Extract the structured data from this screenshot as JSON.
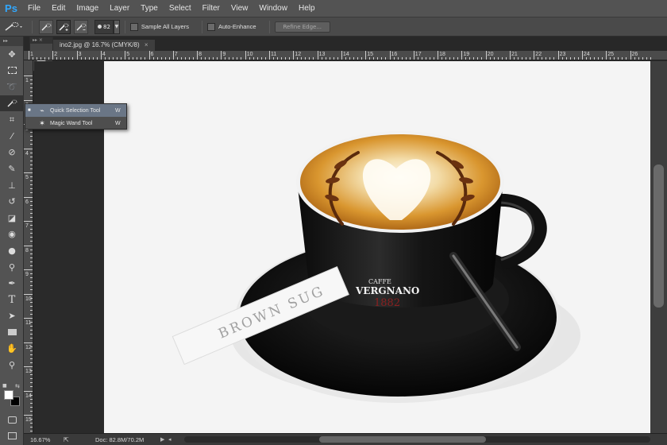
{
  "app": {
    "logo": "Ps"
  },
  "menu": [
    "File",
    "Edit",
    "Image",
    "Layer",
    "Type",
    "Select",
    "Filter",
    "View",
    "Window",
    "Help"
  ],
  "options": {
    "brush_size": "82",
    "sample_all_layers": "Sample All Layers",
    "auto_enhance": "Auto-Enhance",
    "refine_edge": "Refine Edge..."
  },
  "document": {
    "tab_title": "ino2.jpg @ 16.7% (CMYK/8)",
    "close": "×"
  },
  "ruler_top": [
    "1",
    "2",
    "3",
    "4",
    "5",
    "6",
    "7",
    "8",
    "9",
    "10",
    "11",
    "12",
    "13",
    "14",
    "15",
    "16",
    "17",
    "18",
    "19",
    "20",
    "21",
    "22",
    "23",
    "24",
    "25",
    "26"
  ],
  "ruler_left": [
    "1",
    "2",
    "3",
    "4",
    "5",
    "6",
    "7",
    "8",
    "9",
    "10",
    "11",
    "12",
    "13",
    "14",
    "15",
    "16",
    "17",
    "18",
    "19",
    "20"
  ],
  "flyout": [
    {
      "bullet": "■",
      "icon": "quick-selection-icon",
      "label": "Quick Selection Tool",
      "key": "W",
      "active": true
    },
    {
      "bullet": "",
      "icon": "magic-wand-icon",
      "label": "Magic Wand Tool",
      "key": "W",
      "active": false
    }
  ],
  "image": {
    "sugar_text": "BROWN SUG",
    "brand_line1": "CAFFE",
    "brand_line2": "VERGNANO",
    "brand_year": "1882"
  },
  "status": {
    "zoom": "16.67%",
    "doc": "Doc: 82.8M/70.2M"
  },
  "colors": {
    "accent": "#31a8ff",
    "flyout_highlight": "#6a7686"
  }
}
